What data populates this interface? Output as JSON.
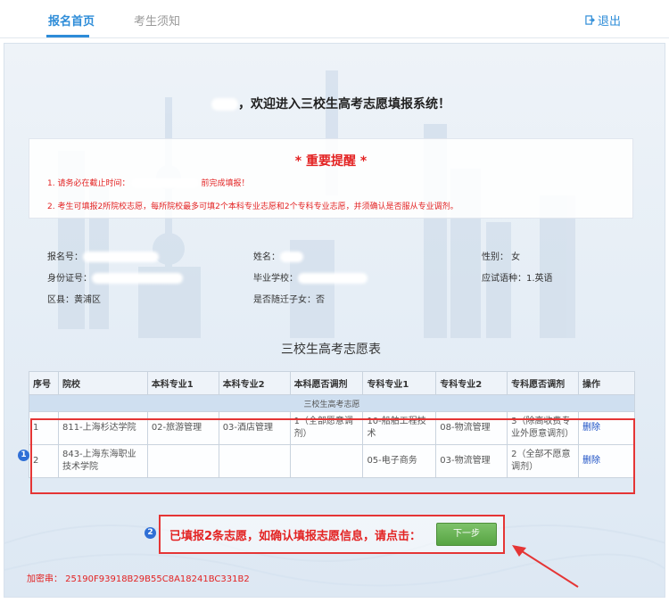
{
  "nav": {
    "tab_home": "报名首页",
    "tab_notice": "考生须知",
    "logout": "退出"
  },
  "welcome": {
    "text": "，欢迎进入三校生高考志愿填报系统！"
  },
  "notice": {
    "title": "* 重要提醒 *",
    "line1_prefix": "1. 请务必在截止时间：",
    "line1_suffix": "前完成填报！",
    "line2": "2. 考生可填报2所院校志愿，每所院校最多可填2个本科专业志愿和2个专科专业志愿，并须确认是否服从专业调剂。"
  },
  "info": {
    "reg_no_label": "报名号：",
    "name_label": "姓名：",
    "gender": "性别： 女",
    "id_label": "身份证号：",
    "school_label": "毕业学校：",
    "language": "应试语种：1.英语",
    "district": "区县：黄浦区",
    "migrant": "是否随迁子女：否"
  },
  "table": {
    "title": "三校生高考志愿表",
    "headers": [
      "序号",
      "院校",
      "本科专业1",
      "本科专业2",
      "本科愿否调剂",
      "专科专业1",
      "专科专业2",
      "专科愿否调剂",
      "操作"
    ],
    "section": "三校生高考志愿",
    "rows": [
      {
        "no": "1",
        "school": "811-上海杉达学院",
        "bk1": "02-旅游管理",
        "bk2": "03-酒店管理",
        "bk_adj": "1（全部愿意调剂）",
        "zk1": "10-船舶工程技术",
        "zk2": "08-物流管理",
        "zk_adj": "3（除高收费专业外愿意调剂）",
        "op": "删除"
      },
      {
        "no": "2",
        "school": "843-上海东海职业技术学院",
        "bk1": "",
        "bk2": "",
        "bk_adj": "",
        "zk1": "05-电子商务",
        "zk2": "03-物流管理",
        "zk_adj": "2（全部不愿意调剂）",
        "op": "删除"
      }
    ]
  },
  "markers": {
    "one": "1",
    "two": "2"
  },
  "confirm": {
    "text": "已填报2条志愿，如确认填报志愿信息，请点击：",
    "next_button": "下一步"
  },
  "code": "加密串： 25190F93918B29B55C8A18241BC331B2",
  "colors": {
    "accent": "#2d8cd8",
    "alert": "#e32222",
    "button": "#57a443"
  }
}
